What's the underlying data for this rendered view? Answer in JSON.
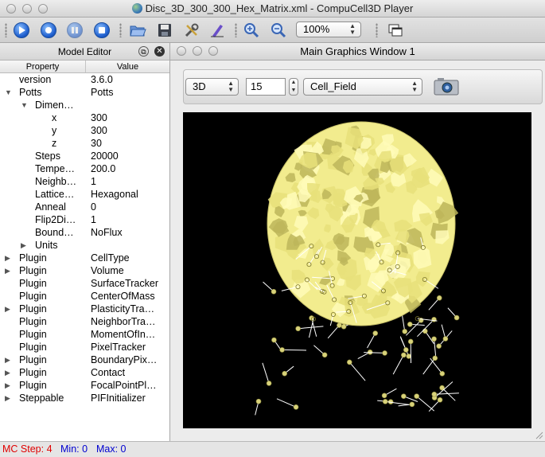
{
  "app_window": {
    "title": "Disc_3D_300_300_Hex_Matrix.xml - CompuCell3D Player"
  },
  "toolbar": {
    "buttons": [
      "run-icon",
      "step-icon",
      "pause-icon",
      "stop-icon",
      "open-icon",
      "save-icon",
      "tools-icon",
      "edit-icon",
      "zoom-in-icon",
      "zoom-out-icon"
    ],
    "zoom_value": "100%"
  },
  "model_editor": {
    "title": "Model Editor",
    "headers": {
      "property": "Property",
      "value": "Value"
    },
    "rows": [
      {
        "prop": "version",
        "val": "3.6.0"
      },
      {
        "prop": "Potts",
        "val": "Potts"
      },
      {
        "prop": "Dimen…",
        "val": ""
      },
      {
        "prop": "x",
        "val": "300"
      },
      {
        "prop": "y",
        "val": "300"
      },
      {
        "prop": "z",
        "val": "30"
      },
      {
        "prop": "Steps",
        "val": "20000"
      },
      {
        "prop": "Tempe…",
        "val": "200.0"
      },
      {
        "prop": "Neighb…",
        "val": "1"
      },
      {
        "prop": "Lattice…",
        "val": "Hexagonal"
      },
      {
        "prop": "Anneal",
        "val": "0"
      },
      {
        "prop": "Flip2Di…",
        "val": "1"
      },
      {
        "prop": "Bound…",
        "val": "NoFlux"
      },
      {
        "prop": "Units",
        "val": ""
      },
      {
        "prop": "Plugin",
        "val": "CellType"
      },
      {
        "prop": "Plugin",
        "val": "Volume"
      },
      {
        "prop": "Plugin",
        "val": "SurfaceTracker"
      },
      {
        "prop": "Plugin",
        "val": "CenterOfMass"
      },
      {
        "prop": "Plugin",
        "val": "PlasticityTra…"
      },
      {
        "prop": "Plugin",
        "val": "NeighborTra…"
      },
      {
        "prop": "Plugin",
        "val": "MomentOfIn…"
      },
      {
        "prop": "Plugin",
        "val": "PixelTracker"
      },
      {
        "prop": "Plugin",
        "val": "BoundaryPix…"
      },
      {
        "prop": "Plugin",
        "val": "Contact"
      },
      {
        "prop": "Plugin",
        "val": "FocalPointPl…"
      },
      {
        "prop": "Steppable",
        "val": "PIFInitializer"
      }
    ]
  },
  "graphics_window": {
    "title": "Main Graphics Window 1",
    "view_mode": "3D",
    "slice_value": "15",
    "field": "Cell_Field",
    "colors": {
      "cell": "#f2ec8e",
      "background": "#000000"
    }
  },
  "status": {
    "mc_step": "MC Step: 4",
    "min": "Min: 0",
    "max": "Max: 0",
    "colors": {
      "mc_step": "#e00000",
      "minmax": "#0000d0"
    }
  }
}
